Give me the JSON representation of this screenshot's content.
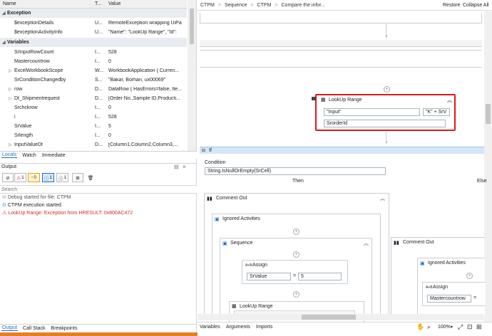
{
  "left": {
    "headers": {
      "name": "Name",
      "type": "T...",
      "value": "Value"
    },
    "groups": {
      "exception": "Exception",
      "variables": "Variables"
    },
    "exception_rows": [
      {
        "name": "$exceptionDetails",
        "type": "U...",
        "value": "RemoteException wrapping UiPa"
      },
      {
        "name": "$exceptionActivityInfo",
        "type": "U...",
        "value": "\"Name\": \"LookUp Range\", \"Id\":"
      }
    ],
    "variable_rows": [
      {
        "name": "SrInputRowCount",
        "type": "I...",
        "value": "528"
      },
      {
        "name": "Mastercountrow",
        "type": "I...",
        "value": "0"
      },
      {
        "name": "ExcelWorkbookScope",
        "type": "W...",
        "value": "WorkbookApplication { Curren..."
      },
      {
        "name": "SrConditionChangedby",
        "type": "S...",
        "value": "\"Bakar, Borhan, ux00069\""
      },
      {
        "name": "row",
        "type": "D...",
        "value": "DataRow { HasErrors=false, Ite..."
      },
      {
        "name": "Dt_Shipmentrequest",
        "type": "D...",
        "value": "[Order No.,Sample ID,Producti..."
      },
      {
        "name": "Srchckrow",
        "type": "I...",
        "value": "0"
      },
      {
        "name": "i",
        "type": "I...",
        "value": "528"
      },
      {
        "name": "SrValue",
        "type": "I...",
        "value": "5"
      },
      {
        "name": "Srlength",
        "type": "I...",
        "value": "0"
      },
      {
        "name": "InputValueDt",
        "type": "D...",
        "value": "[Column1,Column2,Column3,..."
      }
    ],
    "tabs": [
      "Locals",
      "Watch",
      "Immediate"
    ],
    "output_title": "Output",
    "filters": {
      "errors": "1",
      "warnings": "0",
      "info": "1",
      "trace": "1"
    },
    "search_placeholder": "Search",
    "log": [
      "Debug started for file: CTPM",
      "CTPM execution started",
      "LookUp Range: Exception from HRESULT: 0x800AC472"
    ],
    "bottom_tabs": [
      "Output",
      "Call Stack",
      "Breakpoints"
    ]
  },
  "right": {
    "breadcrumb": [
      "CTPM",
      "Sequence",
      "CTPM",
      "Compare the infor..."
    ],
    "restore": "Restore",
    "collapse_all": "Collapse All",
    "lookup1": {
      "title": "LookUp Range",
      "input1": "\"Input\"",
      "input2": "\"K\" + SrV",
      "output": "SrorderId"
    },
    "if": {
      "title": "If",
      "condition_label": "Condition",
      "condition": "String.IsNullOrEmpty(SrCell)",
      "then": "Then",
      "else": "Else"
    },
    "comment_out": "Comment Out",
    "ignored": "Ignored Activities",
    "sequence": "Sequence",
    "assign1": {
      "title": "Assign",
      "to": "SrValue",
      "eq": "=",
      "value": "5"
    },
    "lookup2": "LookUp Range",
    "comment_out2": "Comment Out",
    "ignored2": "Ignored Activities",
    "assign2": {
      "title": "Assign",
      "to": "Mastercountrow",
      "eq": "="
    },
    "bottom_tabs": [
      "Variables",
      "Arguments",
      "Imports"
    ],
    "zoom": "100%"
  },
  "colors": {
    "accent": "#1a6fc9",
    "highlight": "#e0161b",
    "error": "#d42a2a"
  }
}
